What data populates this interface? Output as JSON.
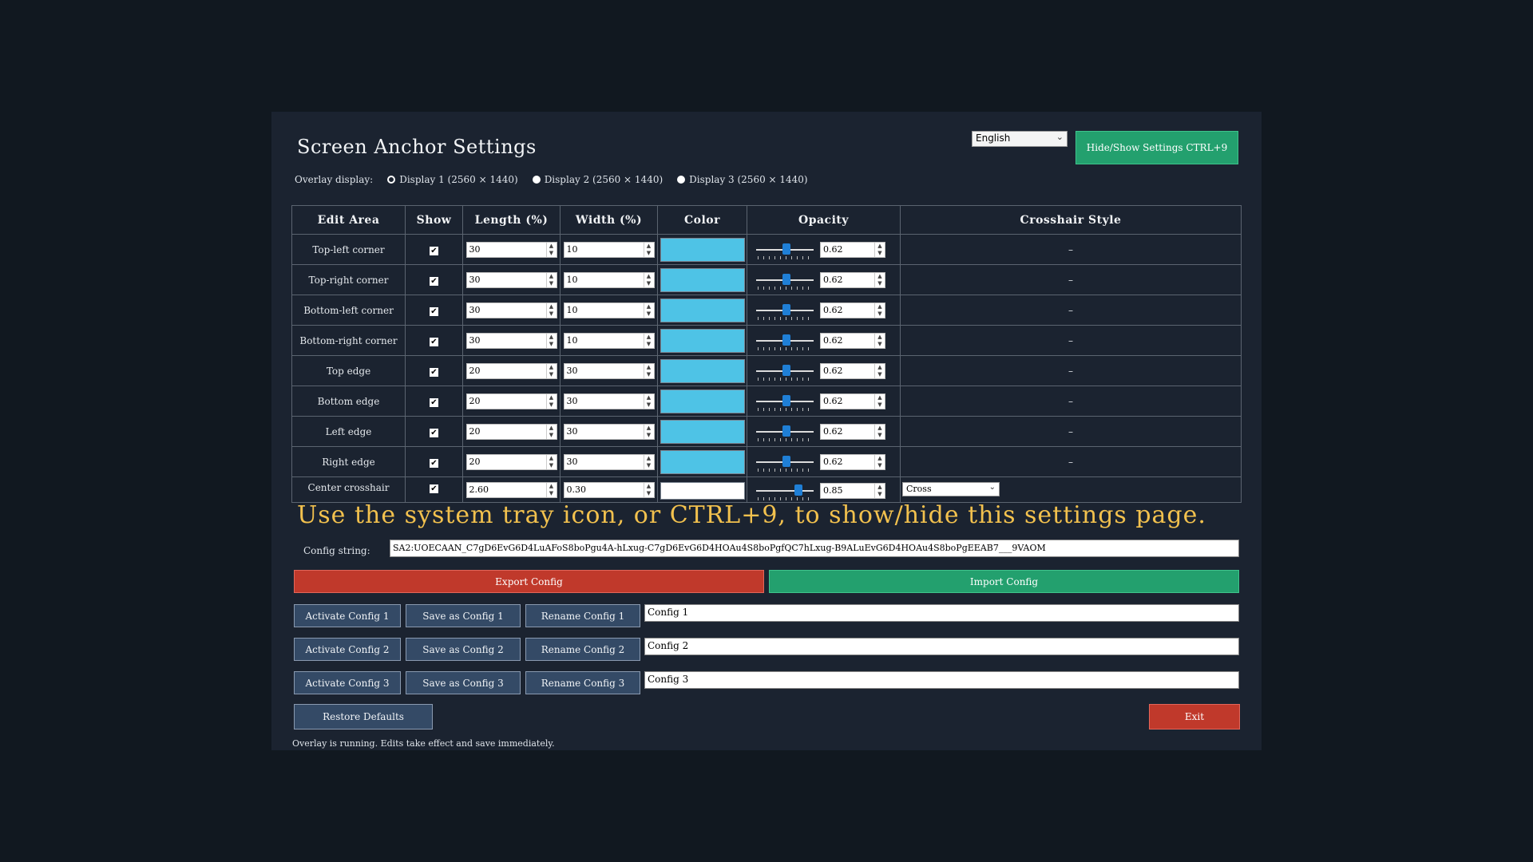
{
  "app": {
    "title": "Screen Anchor Settings",
    "language": "English",
    "hide_show_label": "Hide/Show Settings CTRL+9"
  },
  "overlay": {
    "label": "Overlay display:",
    "options": [
      "Display 1 (2560 × 1440)",
      "Display 2 (2560 × 1440)",
      "Display 3 (2560 × 1440)"
    ],
    "selected": 0
  },
  "table": {
    "headers": [
      "Edit Area",
      "Show",
      "Length (%)",
      "Width (%)",
      "Color",
      "Opacity",
      "Crosshair Style"
    ],
    "rows": [
      {
        "area": "Top-left corner",
        "show": true,
        "length": "30",
        "width": "10",
        "color": "#4ec3e6",
        "opacity": "0.62",
        "style": "–"
      },
      {
        "area": "Top-right corner",
        "show": true,
        "length": "30",
        "width": "10",
        "color": "#4ec3e6",
        "opacity": "0.62",
        "style": "–"
      },
      {
        "area": "Bottom-left corner",
        "show": true,
        "length": "30",
        "width": "10",
        "color": "#4ec3e6",
        "opacity": "0.62",
        "style": "–"
      },
      {
        "area": "Bottom-right corner",
        "show": true,
        "length": "30",
        "width": "10",
        "color": "#4ec3e6",
        "opacity": "0.62",
        "style": "–"
      },
      {
        "area": "Top edge",
        "show": true,
        "length": "20",
        "width": "30",
        "color": "#4ec3e6",
        "opacity": "0.62",
        "style": "–"
      },
      {
        "area": "Bottom edge",
        "show": true,
        "length": "20",
        "width": "30",
        "color": "#4ec3e6",
        "opacity": "0.62",
        "style": "–"
      },
      {
        "area": "Left edge",
        "show": true,
        "length": "20",
        "width": "30",
        "color": "#4ec3e6",
        "opacity": "0.62",
        "style": "–"
      },
      {
        "area": "Right edge",
        "show": true,
        "length": "20",
        "width": "30",
        "color": "#4ec3e6",
        "opacity": "0.62",
        "style": "–"
      },
      {
        "area": "Center crosshair",
        "show": true,
        "length": "2.60",
        "width": "0.30",
        "color": "#ffffff",
        "opacity": "0.85",
        "style": "Cross"
      }
    ]
  },
  "tray_message": "Use the system tray icon, or CTRL+9, to show/hide this settings page.",
  "config": {
    "label": "Config string:",
    "value": "SA2:UOECAAN_C7gD6EvG6D4LuAFoS8boPgu4A-hLxug-C7gD6EvG6D4HOAu4S8boPgfQC7hLxug-B9ALuEvG6D4HOAu4S8boPgEEAB7___9VAOM",
    "export_label": "Export Config",
    "import_label": "Import Config"
  },
  "slots": [
    {
      "activate": "Activate Config 1",
      "save": "Save as Config 1",
      "rename": "Rename Config 1",
      "name": "Config 1"
    },
    {
      "activate": "Activate Config 2",
      "save": "Save as Config 2",
      "rename": "Rename Config 2",
      "name": "Config 2"
    },
    {
      "activate": "Activate Config 3",
      "save": "Save as Config 3",
      "rename": "Rename Config 3",
      "name": "Config 3"
    }
  ],
  "footer": {
    "restore_label": "Restore Defaults",
    "exit_label": "Exit",
    "status": "Overlay is running. Edits take effect and save immediately."
  }
}
